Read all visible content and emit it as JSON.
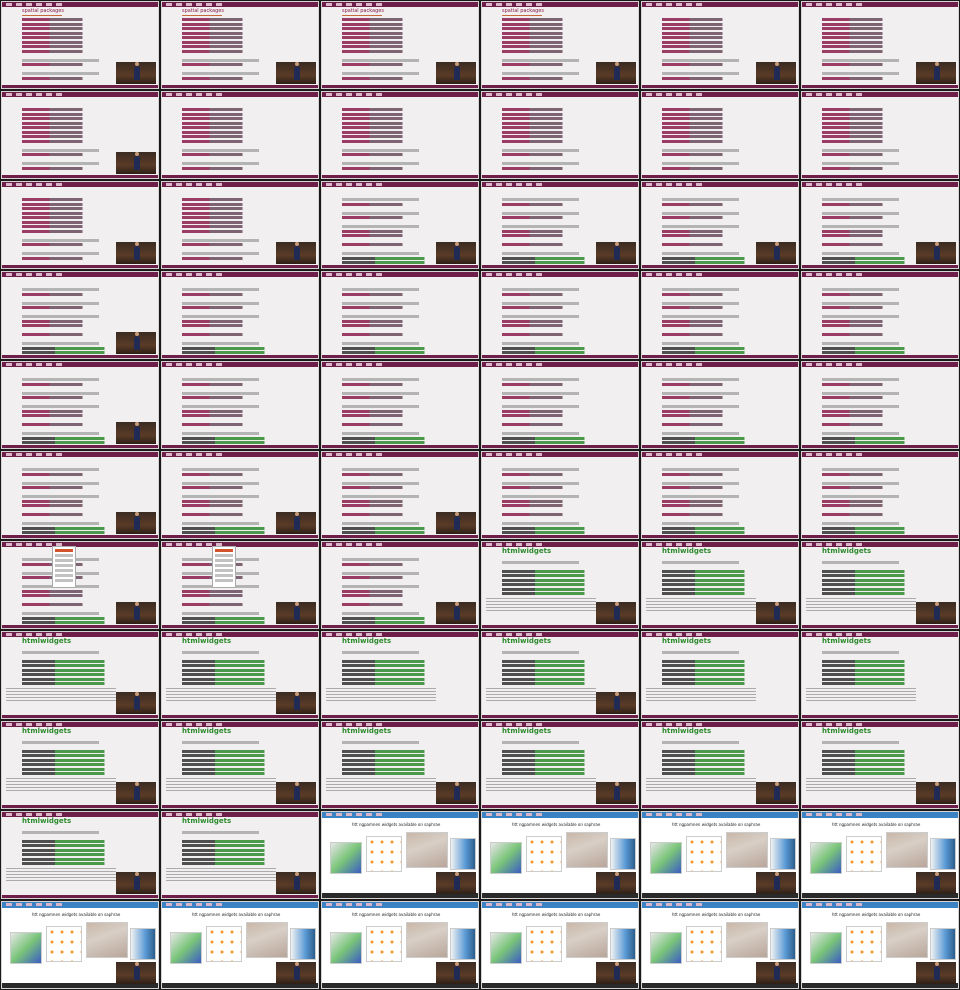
{
  "grid": {
    "cols": 6,
    "rows": 11
  },
  "slides": {
    "spatial_title": "spatial packages",
    "htmlwidgets_title": "htmlwidgets",
    "leaflet_label": "leaflet",
    "widgets_title": "htt ngpamnen widgets available on saphrae"
  },
  "tiles": [
    "code",
    "code",
    "code",
    "code",
    "code-b",
    "code-b",
    "code-b",
    "code-b",
    "code-b",
    "code-b",
    "code-b",
    "code-b",
    "code-b",
    "code-b",
    "code-c",
    "code-c",
    "code-c",
    "code-c",
    "code-c",
    "code-c",
    "code-c",
    "code-c",
    "code-c",
    "code-c",
    "code-c",
    "code-c",
    "code-c",
    "code-c",
    "code-c",
    "code-c",
    "code-c",
    "code-c",
    "code-c",
    "code-c",
    "code-c",
    "code-c",
    "menu",
    "menu",
    "code-c",
    "html",
    "html",
    "html",
    "html",
    "html",
    "html",
    "html",
    "html",
    "html",
    "html",
    "html",
    "html",
    "html",
    "html",
    "html",
    "html",
    "html-b",
    "gallery",
    "gallery",
    "gallery",
    "gallery",
    "gallery",
    "gallery",
    "gallery",
    "gallery",
    "gallery",
    "gallery"
  ]
}
